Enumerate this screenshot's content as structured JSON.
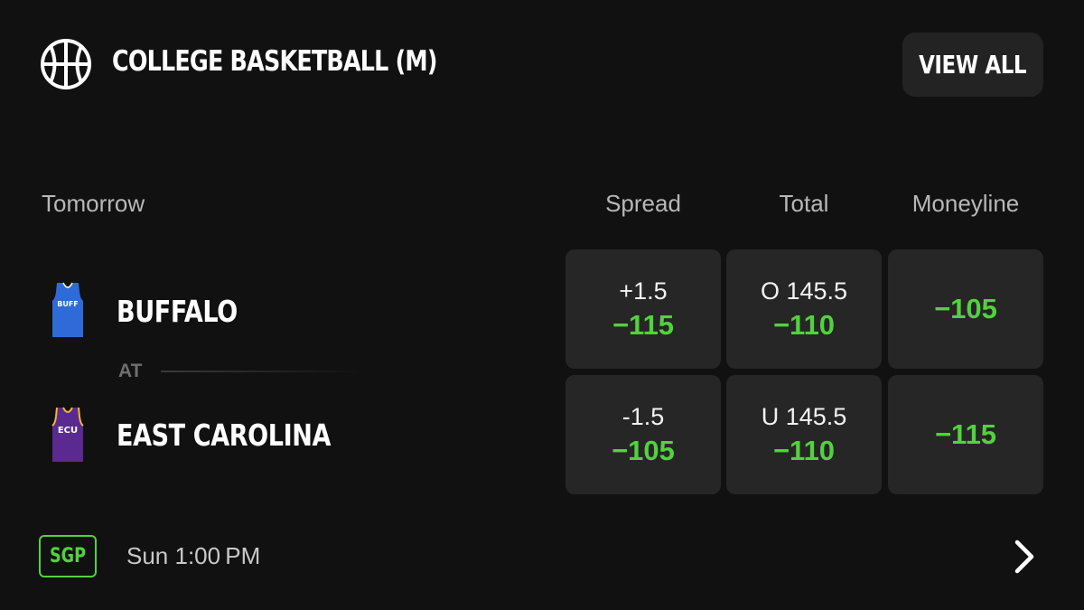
{
  "header": {
    "league_icon": "basketball-icon",
    "title": "COLLEGE BASKETBALL (M)",
    "view_all_label": "VIEW ALL"
  },
  "columns": {
    "date": "Tomorrow",
    "spread": "Spread",
    "total": "Total",
    "moneyline": "Moneyline"
  },
  "game": {
    "away": {
      "name": "BUFFALO",
      "jersey_text": "BUFF",
      "jersey_color": "#2f6bd8",
      "spread_line": "+1.5",
      "spread_price": "−115",
      "total_line": "O 145.5",
      "total_price": "−110",
      "moneyline": "−105"
    },
    "separator": "AT",
    "home": {
      "name": "EAST CAROLINA",
      "jersey_text": "ECU",
      "jersey_color": "#5a2a91",
      "jersey_trim": "#f2b731",
      "spread_line": "-1.5",
      "spread_price": "−105",
      "total_line": "U 145.5",
      "total_price": "−110",
      "moneyline": "−115"
    }
  },
  "footer": {
    "sgp_label": "SGP",
    "time": "Sun 1:00 PM",
    "chevron_icon": "chevron-right-icon"
  },
  "colors": {
    "background": "#111111",
    "cell": "#262626",
    "accent_green": "#52d23e"
  }
}
